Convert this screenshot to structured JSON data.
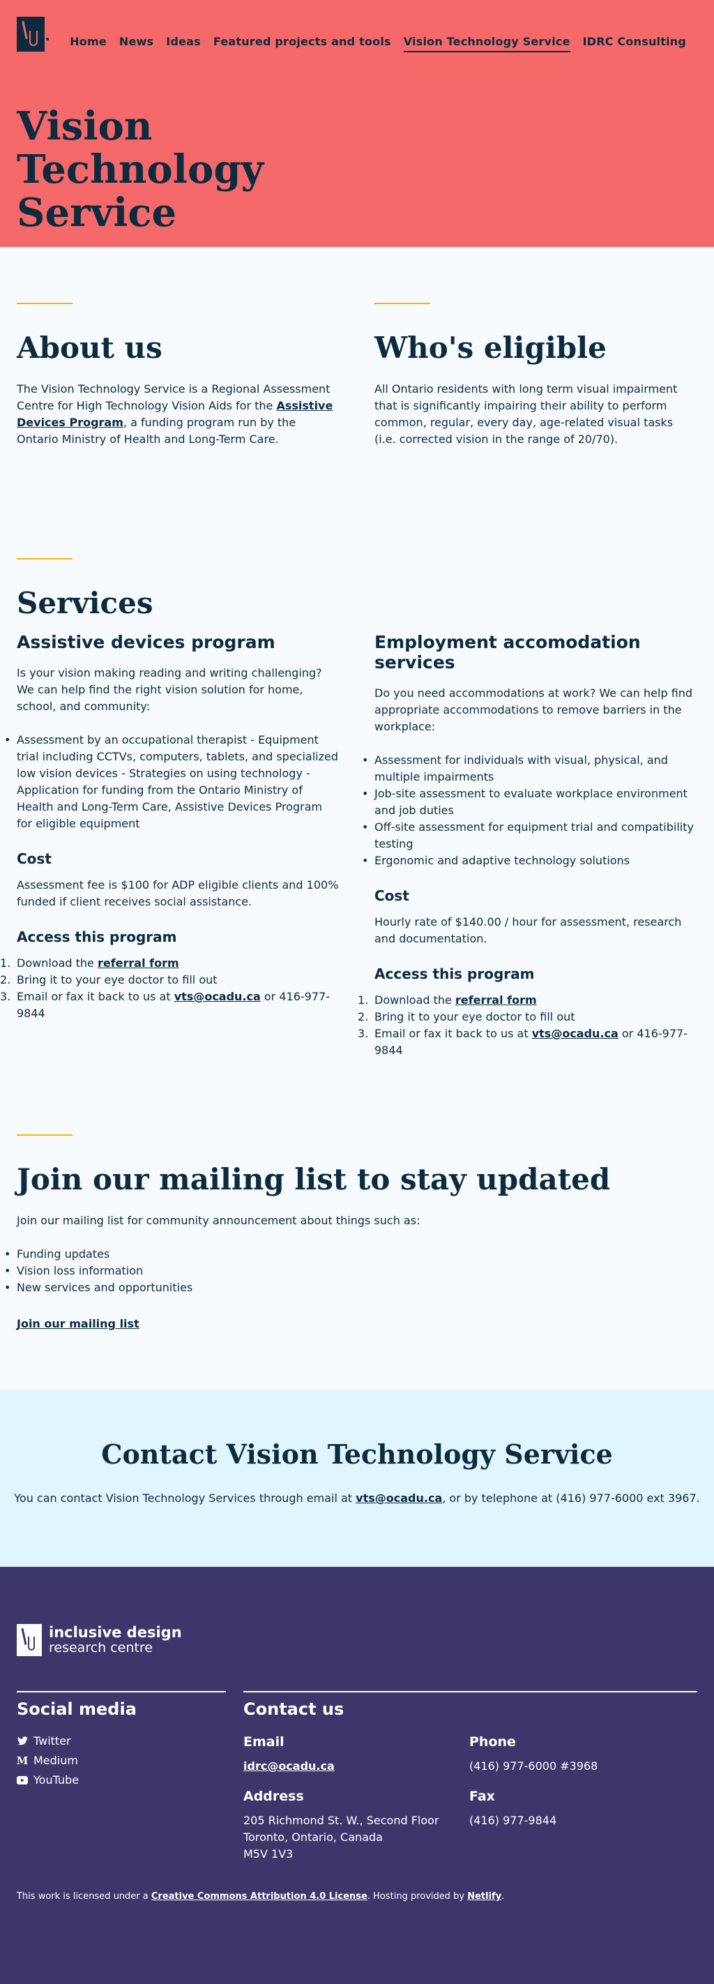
{
  "nav": {
    "items": [
      "Home",
      "News",
      "Ideas",
      "Featured projects and tools",
      "Vision Technology Service",
      "IDRC Consulting"
    ],
    "active": "Vision Technology Service"
  },
  "hero": {
    "title": "Vision Technology Service"
  },
  "about": {
    "heading": "About us",
    "text_before": "The Vision Technology Service is a Regional Assessment Centre for High Technology Vision Aids for the ",
    "link": "Assistive Devices Program",
    "text_after": ", a funding program run by the Ontario Ministry of Health and Long-Term Care."
  },
  "eligible": {
    "heading": "Who's eligible",
    "text": "All Ontario residents with long term visual impairment that is significantly impairing their ability to perform common, regular, every day, age-related visual tasks (i.e. corrected vision in the range of 20/70)."
  },
  "services": {
    "heading": "Services",
    "adp": {
      "title": "Assistive devices program",
      "intro": "Is your vision making reading and writing challenging? We can help find the right vision solution for home, school, and community:",
      "bullets": [
        "Assessment by an occupational therapist - Equipment trial including CCTVs, computers, tablets, and specialized low vision devices - Strategies on using technology - Application for funding from the Ontario Ministry of Health and Long-Term Care, Assistive Devices Program for eligible equipment"
      ],
      "cost_title": "Cost",
      "cost_text": "Assessment fee is $100 for ADP eligible clients and 100% funded if client receives social assistance.",
      "access_title": "Access this program",
      "step1_pre": "Download the ",
      "step1_link": "referral form",
      "step2": "Bring it to your eye doctor to fill out",
      "step3_pre": "Email or fax it back to us at ",
      "step3_link": "vts@ocadu.ca",
      "step3_post": " or 416-977-9844"
    },
    "employment": {
      "title": "Employment accomodation services",
      "intro": "Do you need accommodations at work? We can help find appropriate accommodations to remove barriers in the workplace:",
      "bullets": [
        "Assessment for individuals with visual, physical, and multiple impairments",
        "Job-site assessment to evaluate workplace environment and job duties",
        "Off-site assessment for equipment trial and compatibility testing",
        "Ergonomic and adaptive technology solutions"
      ],
      "cost_title": "Cost",
      "cost_text": "Hourly rate of $140.00 / hour for assessment, research and documentation.",
      "access_title": "Access this program",
      "step1_pre": "Download the ",
      "step1_link": "referral form",
      "step2": "Bring it to your eye doctor to fill out",
      "step3_pre": "Email or fax it back to us at ",
      "step3_link": "vts@ocadu.ca",
      "step3_post": " or 416-977-9844"
    }
  },
  "mailing": {
    "heading": "Join our mailing list to stay updated",
    "intro": "Join our mailing list for community announcement about things such as:",
    "bullets": [
      "Funding updates",
      "Vision loss information",
      "New services and opportunities"
    ],
    "link": "Join our mailing list"
  },
  "contact": {
    "heading": "Contact Vision Technology Service",
    "text_pre": "You can contact Vision Technology Services through email at ",
    "email": "vts@ocadu.ca",
    "text_post": ", or by telephone at (416) 977-6000 ext 3967."
  },
  "footer": {
    "logo_line1": "inclusive design",
    "logo_line2": "research centre",
    "social_title": "Social media",
    "social": [
      {
        "label": "Twitter",
        "icon": "twitter-icon"
      },
      {
        "label": "Medium",
        "icon": "medium-icon"
      },
      {
        "label": "YouTube",
        "icon": "youtube-icon"
      }
    ],
    "contact_title": "Contact us",
    "email_label": "Email",
    "email": "idrc@ocadu.ca",
    "phone_label": "Phone",
    "phone": "(416) 977-6000 #3968",
    "address_label": "Address",
    "address": [
      "205 Richmond St. W., Second Floor",
      "Toronto, Ontario, Canada",
      "M5V 1V3"
    ],
    "fax_label": "Fax",
    "fax": "(416) 977-9844",
    "license_pre": "This work is licensed under a ",
    "license_link": "Creative Commons Attribution 4.0 License",
    "license_mid": ". Hosting provided by ",
    "host_link": "Netlify",
    "license_post": "."
  }
}
